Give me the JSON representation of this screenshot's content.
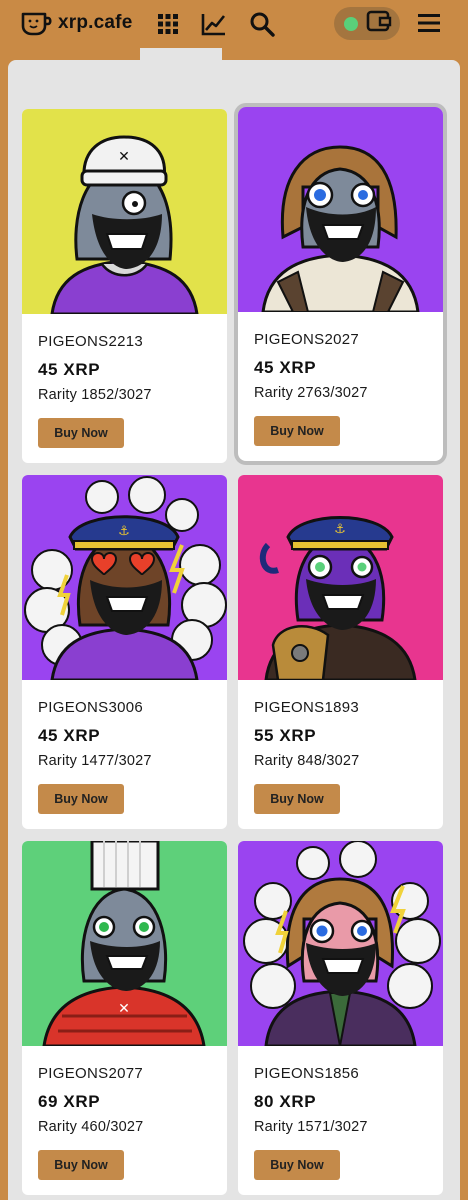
{
  "header": {
    "site_name": "xrp.cafe",
    "icons": [
      "cup-logo-icon",
      "grid-icon",
      "chart-icon",
      "search-icon",
      "wallet-icon",
      "menu-icon"
    ],
    "wallet_status_color": "#5ad07a"
  },
  "colors": {
    "brand": "#c98a45",
    "panel": "#e4e4e4",
    "button": "#c48a4a"
  },
  "listings": [
    {
      "name": "PIGEONS2213",
      "price": "45 XRP",
      "rarity": "Rarity 1852/3027",
      "button": "Buy Now",
      "background": "#e2e24a"
    },
    {
      "name": "PIGEONS2027",
      "price": "45 XRP",
      "rarity": "Rarity 2763/3027",
      "button": "Buy Now",
      "background": "#9a44f0"
    },
    {
      "name": "PIGEONS3006",
      "price": "45 XRP",
      "rarity": "Rarity 1477/3027",
      "button": "Buy Now",
      "background": "#9a44f0"
    },
    {
      "name": "PIGEONS1893",
      "price": "55 XRP",
      "rarity": "Rarity 848/3027",
      "button": "Buy Now",
      "background": "#e8358f"
    },
    {
      "name": "PIGEONS2077",
      "price": "69 XRP",
      "rarity": "Rarity 460/3027",
      "button": "Buy Now",
      "background": "#5ed07a"
    },
    {
      "name": "PIGEONS1856",
      "price": "80 XRP",
      "rarity": "Rarity 1571/3027",
      "button": "Buy Now",
      "background": "#9a44f0"
    }
  ]
}
